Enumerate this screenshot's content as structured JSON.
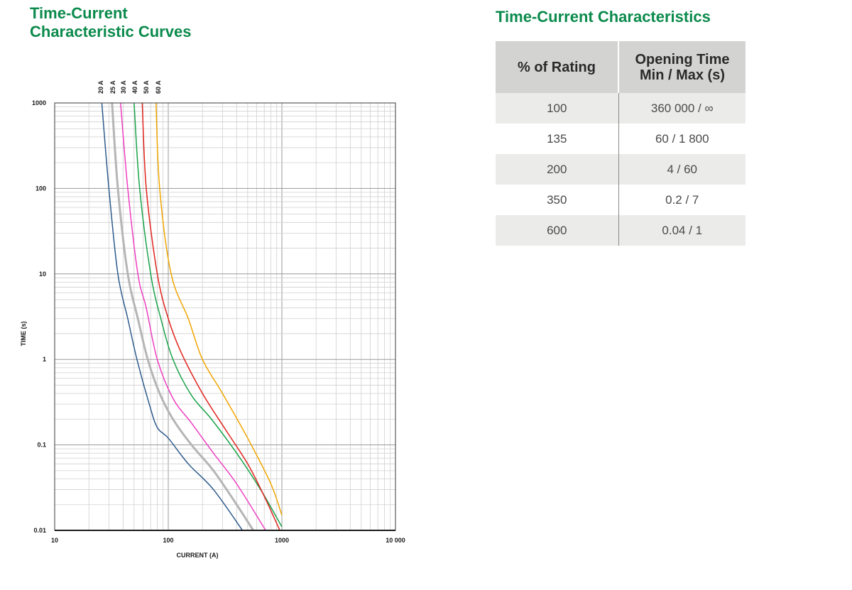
{
  "chart_title_lines": [
    "Time-Current",
    "Characteristic Curves"
  ],
  "table_title": "Time-Current Characteristics",
  "table": {
    "headers": [
      "% of Rating",
      "Opening Time\nMin / Max (s)"
    ],
    "rows": [
      [
        "100",
        "360 000 / ∞"
      ],
      [
        "135",
        "60 / 1 800"
      ],
      [
        "200",
        "4 / 60"
      ],
      [
        "350",
        "0.2 / 7"
      ],
      [
        "600",
        "0.04 / 1"
      ]
    ]
  },
  "chart_data": {
    "type": "line",
    "title": "",
    "xlabel": "CURRENT (A)",
    "ylabel": "TIME (s)",
    "xscale": "log",
    "yscale": "log",
    "xlim": [
      10,
      10000
    ],
    "ylim": [
      0.01,
      1000
    ],
    "x_tick_labels": [
      "10",
      "100",
      "1000",
      "10 000"
    ],
    "y_tick_labels": [
      "1000",
      "100",
      "10",
      "1",
      "0.1",
      "0.01"
    ],
    "grid": true,
    "legend": "series labels above plot top",
    "series": [
      {
        "name": "20 A",
        "color": "#2d5a8c",
        "width": 1.5,
        "points": [
          [
            26,
            1000
          ],
          [
            30,
            100
          ],
          [
            36,
            10
          ],
          [
            44,
            3
          ],
          [
            53,
            1
          ],
          [
            68,
            0.3
          ],
          [
            80,
            0.16
          ],
          [
            100,
            0.12
          ],
          [
            150,
            0.06
          ],
          [
            250,
            0.03
          ],
          [
            450,
            0.01
          ]
        ]
      },
      {
        "name": "25 A",
        "color": "#b5b5b5",
        "width": 3,
        "points": [
          [
            32,
            1000
          ],
          [
            36,
            100
          ],
          [
            44,
            10
          ],
          [
            54,
            3
          ],
          [
            66,
            1
          ],
          [
            84,
            0.4
          ],
          [
            110,
            0.2
          ],
          [
            160,
            0.1
          ],
          [
            250,
            0.05
          ],
          [
            400,
            0.02
          ],
          [
            560,
            0.01
          ]
        ]
      },
      {
        "name": "30 A",
        "color": "#ee3ec0",
        "width": 1.5,
        "points": [
          [
            38,
            1000
          ],
          [
            44,
            100
          ],
          [
            54,
            10
          ],
          [
            64,
            4
          ],
          [
            80,
            1
          ],
          [
            110,
            0.35
          ],
          [
            160,
            0.18
          ],
          [
            250,
            0.08
          ],
          [
            400,
            0.035
          ],
          [
            720,
            0.01
          ]
        ]
      },
      {
        "name": "40 A",
        "color": "#1aa34a",
        "width": 1.5,
        "points": [
          [
            50,
            1000
          ],
          [
            56,
            100
          ],
          [
            70,
            10
          ],
          [
            86,
            3
          ],
          [
            110,
            1
          ],
          [
            160,
            0.38
          ],
          [
            240,
            0.2
          ],
          [
            400,
            0.08
          ],
          [
            650,
            0.03
          ],
          [
            1000,
            0.011
          ]
        ]
      },
      {
        "name": "50 A",
        "color": "#e0221c",
        "width": 1.5,
        "points": [
          [
            59,
            1000
          ],
          [
            64,
            100
          ],
          [
            80,
            10
          ],
          [
            100,
            3
          ],
          [
            130,
            1.2
          ],
          [
            200,
            0.4
          ],
          [
            320,
            0.15
          ],
          [
            500,
            0.06
          ],
          [
            700,
            0.025
          ],
          [
            960,
            0.01
          ]
        ]
      },
      {
        "name": "60 A",
        "color": "#f0a500",
        "width": 1.5,
        "points": [
          [
            78,
            1000
          ],
          [
            84,
            100
          ],
          [
            106,
            10
          ],
          [
            150,
            3
          ],
          [
            200,
            1
          ],
          [
            300,
            0.4
          ],
          [
            500,
            0.12
          ],
          [
            800,
            0.035
          ],
          [
            1000,
            0.015
          ]
        ]
      }
    ]
  }
}
